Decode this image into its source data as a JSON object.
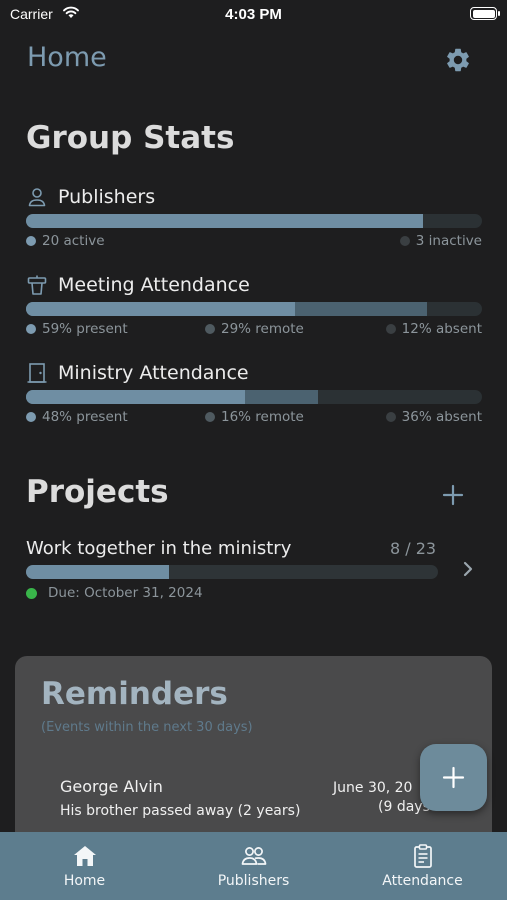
{
  "status_bar": {
    "carrier": "Carrier",
    "time": "4:03 PM"
  },
  "header": {
    "title": "Home"
  },
  "group_stats": {
    "title": "Group Stats",
    "publishers": {
      "label": "Publishers",
      "icon": "person-icon",
      "active_fraction": 0.87,
      "active_text": "20 active",
      "inactive_text": "3 inactive"
    },
    "meeting": {
      "label": "Meeting Attendance",
      "icon": "podium-icon",
      "present_fraction": 0.59,
      "remote_fraction": 0.29,
      "present_text": "59% present",
      "remote_text": "29% remote",
      "absent_text": "12% absent"
    },
    "ministry": {
      "label": "Ministry Attendance",
      "icon": "door-icon",
      "present_fraction": 0.48,
      "remote_fraction": 0.16,
      "present_text": "48% present",
      "remote_text": "16% remote",
      "absent_text": "36% absent"
    }
  },
  "projects": {
    "title": "Projects",
    "items": [
      {
        "name": "Work together in the ministry",
        "count": "8 / 23",
        "progress": 0.3478,
        "due": "Due: October 31, 2024"
      }
    ]
  },
  "reminders": {
    "title": "Reminders",
    "subtitle": "(Events within the next 30 days)",
    "items": [
      {
        "name": "George Alvin",
        "detail": "His brother passed away (2 years)",
        "date": "June 30, 20",
        "days": "(9 days"
      }
    ]
  },
  "tabs": [
    {
      "label": "Home",
      "icon": "home-icon"
    },
    {
      "label": "Publishers",
      "icon": "people-icon"
    },
    {
      "label": "Attendance",
      "icon": "clipboard-icon"
    }
  ],
  "colors": {
    "accent": "#7d9bb0",
    "tabbar": "#5d7d8e",
    "fab": "#6d8b9b",
    "due_dot": "#39b54a"
  }
}
